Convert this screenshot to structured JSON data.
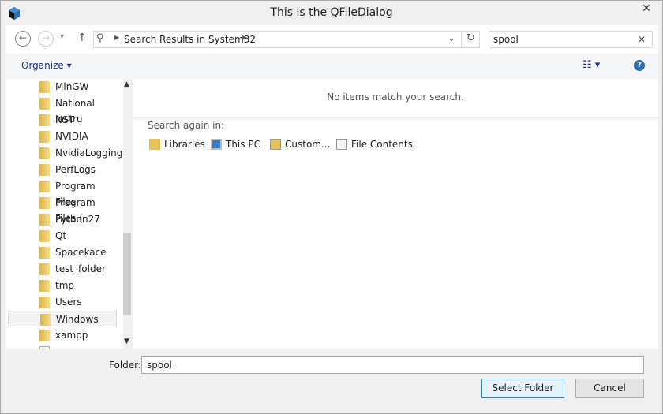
{
  "window": {
    "title": "This is the QFileDialog",
    "close": "✕"
  },
  "nav": {
    "back": "←",
    "forward": "→",
    "recent": "▾",
    "up": "↑",
    "breadcrumb": "Search Results in System32",
    "dropdown": "⌄",
    "refresh": "↻",
    "search_value": "spool",
    "clear": "✕"
  },
  "toolbar": {
    "organize": "Organize ▾",
    "view": "☷ ▾",
    "help": "?"
  },
  "sidebar": {
    "items": [
      {
        "label": "MinGW"
      },
      {
        "label": "National Instru"
      },
      {
        "label": "NST"
      },
      {
        "label": "NVIDIA"
      },
      {
        "label": "NvidiaLogging"
      },
      {
        "label": "PerfLogs"
      },
      {
        "label": "Program Files"
      },
      {
        "label": "Program Files ("
      },
      {
        "label": "Python27"
      },
      {
        "label": "Qt"
      },
      {
        "label": "Spacekace"
      },
      {
        "label": "test_folder"
      },
      {
        "label": "tmp"
      },
      {
        "label": "Users"
      },
      {
        "label": "Windows"
      },
      {
        "label": "xampp"
      }
    ],
    "selected": "Windows"
  },
  "main": {
    "empty_message": "No items match your search.",
    "search_again": "Search again in:",
    "links": [
      "Libraries",
      "This PC",
      "Custom...",
      "File Contents"
    ]
  },
  "footer": {
    "folder_label": "Folder:",
    "folder_value": "spool",
    "select": "Select Folder",
    "cancel": "Cancel"
  }
}
